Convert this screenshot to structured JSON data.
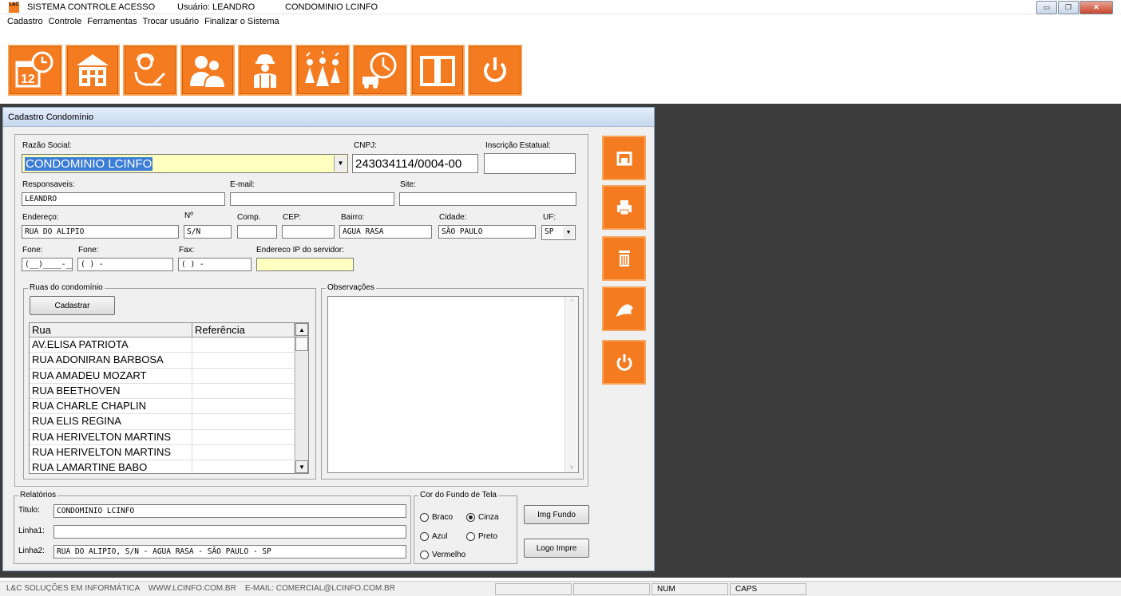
{
  "titlebar": {
    "app_icon_text": "L&C",
    "app_name": "SISTEMA CONTROLE ACESSO",
    "user": "Usuário: LEANDRO",
    "condo": "CONDOMINIO LCINFO"
  },
  "menu": [
    "Cadastro",
    "Controle",
    "Ferramentas",
    "Trocar usuário",
    "Finalizar o Sistema"
  ],
  "toolbar": {
    "accent": "#f47b20",
    "icons": [
      "calendar-clock-icon",
      "building-icon",
      "receptionist-icon",
      "people-icon",
      "worker-icon",
      "crowd-icon",
      "delivery-clock-icon",
      "book-icon",
      "power-icon"
    ],
    "calendar_day": "12"
  },
  "form": {
    "window_title": "Cadastro Condomínio",
    "labels": {
      "razao": "Razão Social:",
      "cnpj": "CNPJ:",
      "ie": "Inscrição Estatual:",
      "resp": "Responsaveis:",
      "email": "E-mail:",
      "site": "Site:",
      "endereco": "Endereço:",
      "numero": "Nº",
      "comp": "Comp.",
      "cep": "CEP:",
      "bairro": "Bairro:",
      "cidade": "Cidade:",
      "uf": "UF:",
      "fone1": "Fone:",
      "fone2": "Fone:",
      "fax": "Fax:",
      "ip": "Endereco IP do servidor:"
    },
    "values": {
      "razao": "CONDOMINIO LCINFO",
      "cnpj": "243034114/0004-00",
      "ie": "",
      "resp": "LEANDRO",
      "email": "",
      "site": "",
      "endereco": "RUA DO ALIPIO",
      "numero": "S/N",
      "comp": "",
      "cep": "",
      "bairro": "AGUA RASA",
      "cidade": "SÃO PAULO",
      "uf": "SP",
      "fone1": "(__)____-____",
      "fone2": "(  )    -",
      "fax": "(  )    -",
      "ip": ""
    }
  },
  "ruas": {
    "group_label": "Ruas do condomínio",
    "cadastrar": "Cadastrar",
    "columns": [
      "Rua",
      "Referência"
    ],
    "rows": [
      [
        "AV.ELISA  PATRIOTA",
        ""
      ],
      [
        "RUA ADONIRAN BARBOSA",
        ""
      ],
      [
        "RUA AMADEU MOZART",
        ""
      ],
      [
        "RUA BEETHOVEN",
        ""
      ],
      [
        "RUA CHARLE CHAPLIN",
        ""
      ],
      [
        "RUA ELIS REGINA",
        ""
      ],
      [
        "RUA HERIVELTON MARTINS",
        ""
      ],
      [
        "RUA HERIVELTON MARTINS",
        ""
      ],
      [
        "RUA LAMARTINE BABO",
        ""
      ]
    ]
  },
  "obs": {
    "group_label": "Observações",
    "text": ""
  },
  "relatorios": {
    "group_label": "Relatórios",
    "titulo_label": "Titulo:",
    "linha1_label": "Linha1:",
    "linha2_label": "Linha2:",
    "titulo": "CONDOMINIO LCINFO",
    "linha1": "",
    "linha2": "RUA DO ALIPIO, S/N - AGUA RASA - SÃO PAULO - SP"
  },
  "cor_fundo": {
    "group_label": "Cor do Fundo de Tela",
    "options": [
      "Braco",
      "Cinza",
      "Azul",
      "Preto",
      "Vermelho"
    ],
    "selected": "Cinza"
  },
  "buttons": {
    "img_fundo": "Img Fundo",
    "logo_impre": "Logo Impre"
  },
  "side_buttons": [
    "save-icon",
    "print-icon",
    "trash-icon",
    "broom-icon",
    "power-icon"
  ],
  "status": {
    "company": "L&C SOLUÇÕES EM INFORMÁTICA    WWW.LCINFO.COM.BR    E-MAIL: COMERCIAL@LCINFO.COM.BR",
    "num": "NUM",
    "caps": "CAPS"
  }
}
